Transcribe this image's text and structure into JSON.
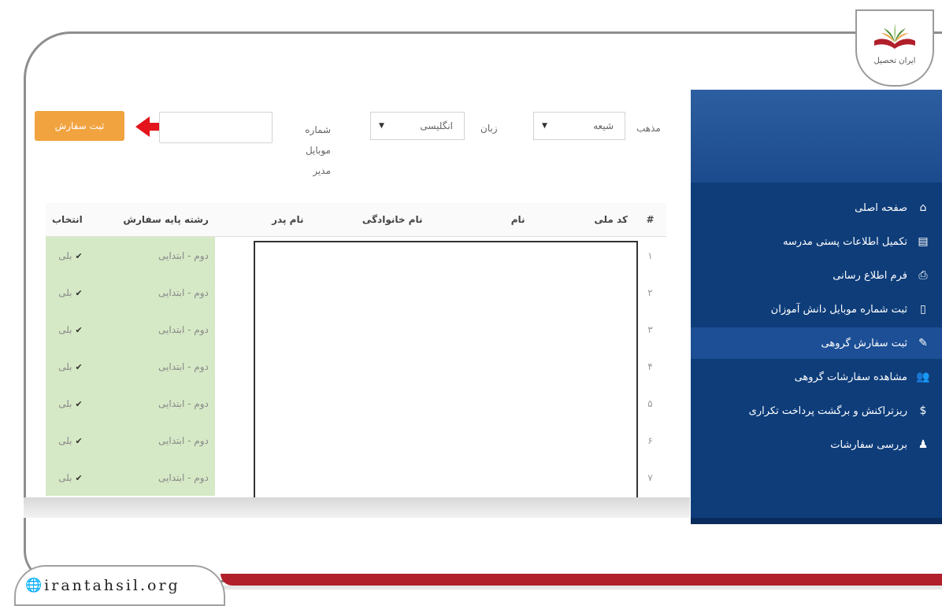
{
  "watermark": {
    "logo_text": "ایران تحصیل",
    "site_url": "irantahsil.org"
  },
  "sidebar": {
    "items": [
      {
        "label": "صفحه اصلی",
        "icon": "home-icon",
        "glyph": "⌂",
        "active": false
      },
      {
        "label": "تکمیل اطلاعات پستی مدرسه",
        "icon": "id-card-icon",
        "glyph": "▤",
        "active": false
      },
      {
        "label": "فرم اطلاع رسانی",
        "icon": "print-icon",
        "glyph": "⎙",
        "active": false
      },
      {
        "label": "ثبت شماره موبایل دانش آموزان",
        "icon": "mobile-icon",
        "glyph": "▯",
        "active": false
      },
      {
        "label": "ثبت سفارش گروهی",
        "icon": "edit-icon",
        "glyph": "✎",
        "active": true
      },
      {
        "label": "مشاهده سفارشات گروهی",
        "icon": "users-icon",
        "glyph": "👥",
        "active": false
      },
      {
        "label": "ریزتراکنش و برگشت پرداخت تکراری",
        "icon": "dollar-icon",
        "glyph": "$",
        "active": false
      },
      {
        "label": "بررسی سفارشات",
        "icon": "user-icon",
        "glyph": "♟",
        "active": false
      }
    ]
  },
  "form": {
    "religion_label": "مذهب",
    "religion_value": "شیعه",
    "language_label": "زبان",
    "language_value": "انگلیسی",
    "mobile_label": "شماره موبایل مدیر",
    "mobile_value": "",
    "submit_label": "ثبت سفارش"
  },
  "table": {
    "headers": {
      "index": "#",
      "national_code": "کد ملی",
      "first_name": "نام",
      "last_name": "نام خانوادگی",
      "father_name": "نام پدر",
      "grade": "رشته پایه سفارش",
      "select": "انتخاب"
    },
    "rows": [
      {
        "index": "۱",
        "grade": "دوم - ابتدایی",
        "select": "بلی"
      },
      {
        "index": "۲",
        "grade": "دوم - ابتدایی",
        "select": "بلی"
      },
      {
        "index": "۳",
        "grade": "دوم - ابتدایی",
        "select": "بلی"
      },
      {
        "index": "۴",
        "grade": "دوم - ابتدایی",
        "select": "بلی"
      },
      {
        "index": "۵",
        "grade": "دوم - ابتدایی",
        "select": "بلی"
      },
      {
        "index": "۶",
        "grade": "دوم - ابتدایی",
        "select": "بلی"
      },
      {
        "index": "۷",
        "grade": "دوم - ابتدایی",
        "select": "بلی"
      }
    ]
  },
  "colors": {
    "sidebar_bg": "#0e3d7a",
    "submit_button": "#f1a340",
    "row_highlight": "#d6e9c6",
    "brand_red": "#b01f2a"
  }
}
